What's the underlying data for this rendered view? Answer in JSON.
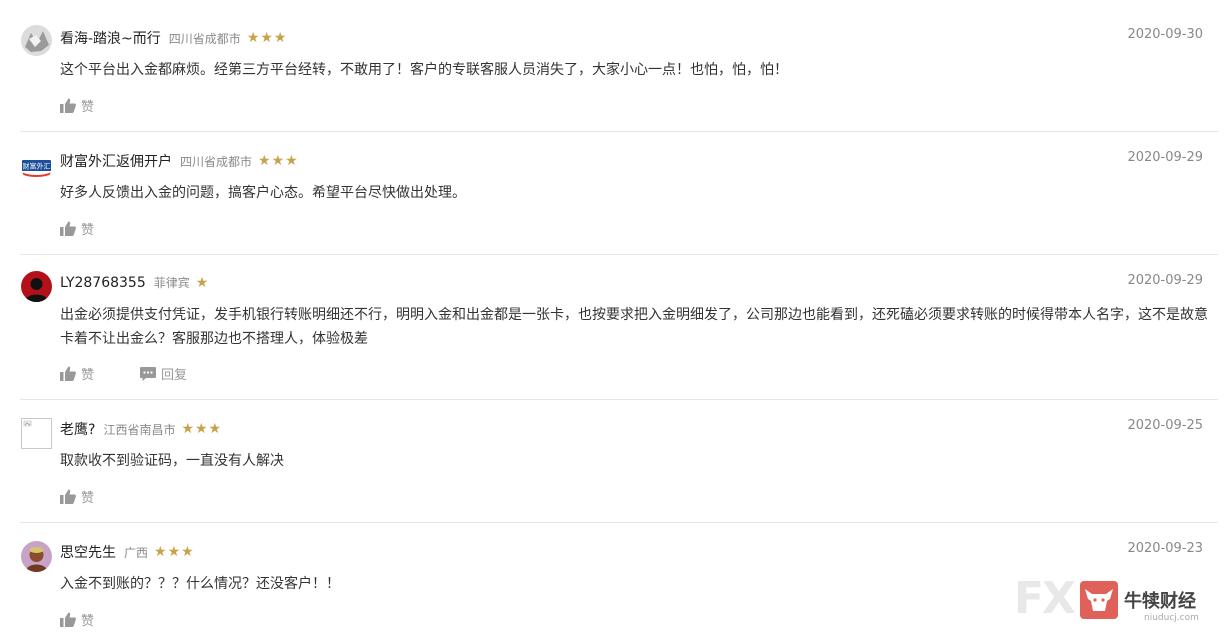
{
  "comments": [
    {
      "name": "看海-踏浪~而行",
      "location": "四川省成都市",
      "stars": "★★★",
      "date": "2020-09-30",
      "text": "这个平台出入金都麻烦。经第三方平台经转，不敢用了！客户的专联客服人员消失了，大家小心一点！也怕，怕，怕！",
      "like_label": "赞"
    },
    {
      "name": "财富外汇返佣开户",
      "location": "四川省成都市",
      "stars": "★★★",
      "date": "2020-09-29",
      "text": "好多人反馈出入金的问题，搞客户心态。希望平台尽快做出处理。",
      "like_label": "赞",
      "avatar_text": "财富外汇"
    },
    {
      "name": "LY28768355",
      "location": "菲律宾",
      "stars": "★",
      "date": "2020-09-29",
      "text": "出金必须提供支付凭证，发手机银行转账明细还不行，明明入金和出金都是一张卡，也按要求把入金明细发了，公司那边也能看到，还死磕必须要求转账的时候得带本人名字，这不是故意卡着不让出金么？客服那边也不搭理人，体验极差",
      "like_label": "赞",
      "reply_label": "回复"
    },
    {
      "name": "老鹰?",
      "location": "江西省南昌市",
      "stars": "★★★",
      "date": "2020-09-25",
      "text": "取款收不到验证码，一直没有人解决",
      "like_label": "赞"
    },
    {
      "name": "思空先生",
      "location": "广西",
      "stars": "★★★",
      "date": "2020-09-23",
      "text": "入金不到账的？？？什么情况？还没客户！！",
      "like_label": "赞"
    }
  ],
  "watermark": {
    "brand": "FX",
    "name": "牛犊财经",
    "url": "niuducj.com"
  },
  "colors": {
    "star": "#c8a24a",
    "divider": "#e6e6e6",
    "meta_text": "#888888"
  }
}
